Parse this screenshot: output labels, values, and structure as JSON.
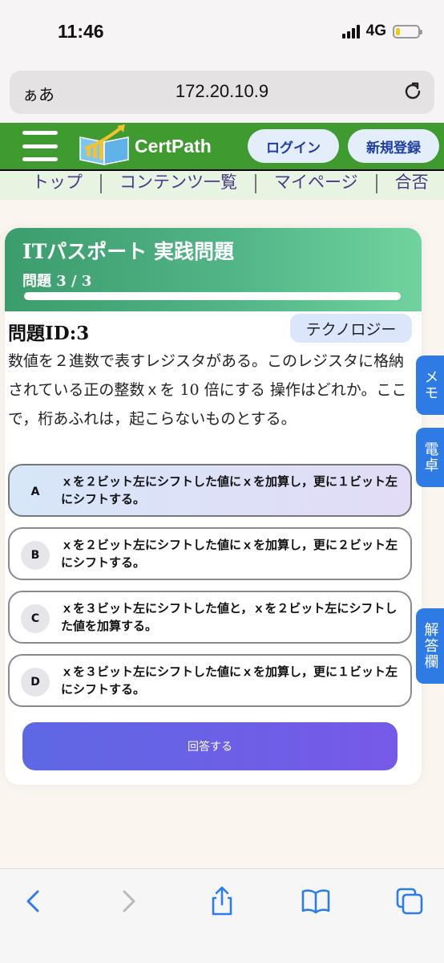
{
  "status_bar": {
    "time": "11:46",
    "network": "4G",
    "battery_level": 0.2,
    "battery_color": "#f5c518"
  },
  "browser": {
    "aa_label": "ぁあ",
    "url": "172.20.10.9"
  },
  "header": {
    "logo_text": "CertPath",
    "login_label": "ログイン",
    "signup_label": "新規登録",
    "brand_color": "#3f9a2f"
  },
  "nav": {
    "items": [
      "トップ",
      "コンテンツ一覧",
      "マイページ",
      "合否"
    ]
  },
  "card": {
    "title": "ITパスポート 実践問題",
    "count": "問題 3 / 3",
    "progress": 1.0,
    "question_id": "問題ID:3",
    "category": "テクノロジー",
    "question_text": "数値を２進数で表すレジスタがある。このレジスタに格納されている正の整数ｘを 10 倍にする 操作はどれか。ここで，桁あふれは，起こらないものとする。",
    "choices": [
      {
        "letter": "A",
        "text": "ｘを２ビット左にシフトした値にｘを加算し，更に１ビット左にシフトする。",
        "selected": true
      },
      {
        "letter": "B",
        "text": "ｘを２ビット左にシフトした値にｘを加算し，更に２ビット左にシフトする。",
        "selected": false
      },
      {
        "letter": "C",
        "text": "ｘを３ビット左にシフトした値と，ｘを２ビット左にシフトした値を加算する。",
        "selected": false
      },
      {
        "letter": "D",
        "text": "ｘを３ビット左にシフトした値にｘを加算し，更に１ビット左にシフトする。",
        "selected": false
      }
    ],
    "submit_label": "回答する"
  },
  "side_tabs": {
    "memo": "メモ",
    "calc": "電卓",
    "answer": "解答欄",
    "color": "#2f7be6"
  },
  "toolbar": {
    "icons": [
      "back-icon",
      "forward-icon",
      "share-icon",
      "bookmarks-icon",
      "tabs-icon"
    ]
  }
}
